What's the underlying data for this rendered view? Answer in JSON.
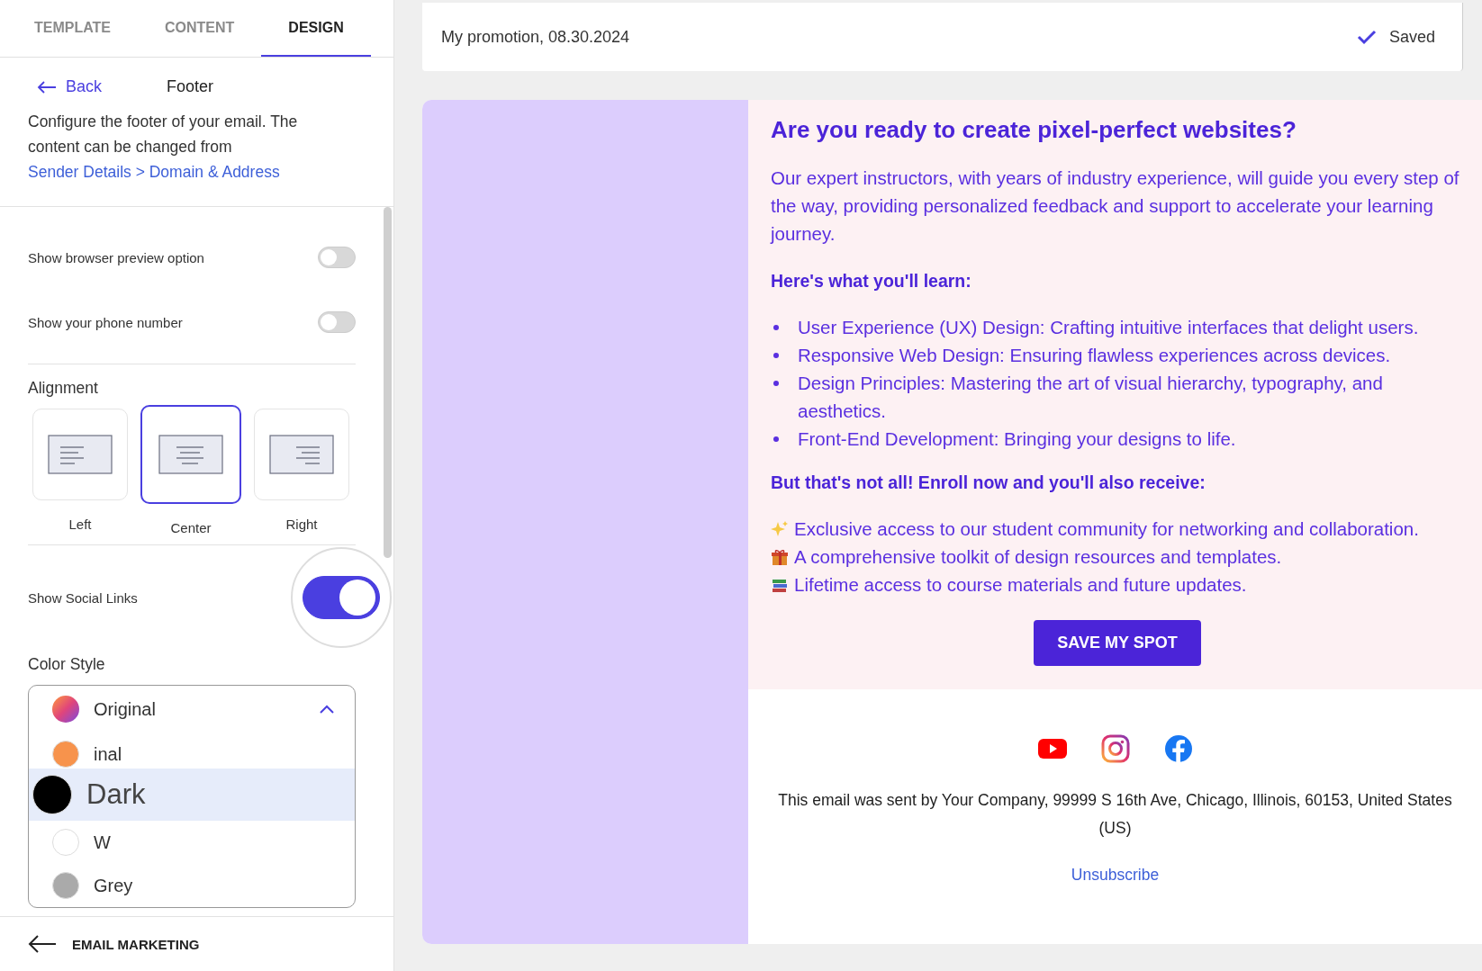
{
  "tabs": [
    {
      "label": "TEMPLATE",
      "selected": false
    },
    {
      "label": "CONTENT",
      "selected": false
    },
    {
      "label": "DESIGN",
      "selected": true
    }
  ],
  "panel": {
    "back": "Back",
    "title": "Footer",
    "description": "Configure the footer of your email. The content can be changed from",
    "link": "Sender Details > Domain & Address"
  },
  "toggles": [
    {
      "label": "Show browser preview option",
      "on": false
    },
    {
      "label": "Show your phone number",
      "on": false
    }
  ],
  "alignment": {
    "label": "Alignment",
    "options": [
      {
        "label": "Left",
        "kind": "left",
        "selected": false
      },
      {
        "label": "Center",
        "kind": "center",
        "selected": true
      },
      {
        "label": "Right",
        "kind": "right",
        "selected": false
      }
    ]
  },
  "social_toggle": {
    "label": "Show Social Links",
    "on": true
  },
  "color_style": {
    "label": "Color Style",
    "value": "Original",
    "expanded": true,
    "options": [
      {
        "label": "inal",
        "color": "#f7934c",
        "selected": false
      },
      {
        "label": "Dark",
        "color": "#000000",
        "selected": true
      },
      {
        "label": "W",
        "color": "#ffffff",
        "selected": false
      },
      {
        "label": "Grey",
        "color": "#aaaaaa",
        "selected": false
      }
    ]
  },
  "bottom_nav": {
    "label": "EMAIL MARKETING"
  },
  "header": {
    "title": "My promotion, 08.30.2024",
    "status": "Saved"
  },
  "email": {
    "heading": "Are you ready to create pixel-perfect websites?",
    "intro": "Our expert instructors, with years of industry experience, will guide you every step of the way, providing personalized feedback and support to accelerate your learning journey.",
    "learn_heading": "Here's what you'll learn:",
    "learn_items": [
      "User Experience (UX) Design: Crafting intuitive interfaces that delight users.",
      "Responsive Web Design: Ensuring flawless experiences across devices.",
      "Design Principles: Mastering the art of visual hierarchy, typography, and aesthetics.",
      "Front-End Development: Bringing your designs to life."
    ],
    "bonus_heading": "But that's not all! Enroll now and you'll also receive:",
    "bonus_items": [
      {
        "kind": "sparkles",
        "text": "Exclusive access to our student community for networking and collaboration."
      },
      {
        "kind": "gift",
        "text": "A comprehensive toolkit of design resources and templates."
      },
      {
        "kind": "books",
        "text": "Lifetime access to course materials and future updates."
      }
    ],
    "cta": "SAVE MY SPOT",
    "address": "This email was sent by Your Company, 99999 S 16th Ave, Chicago, Illinois, 60153, United States (US)",
    "unsubscribe": "Unsubscribe"
  }
}
